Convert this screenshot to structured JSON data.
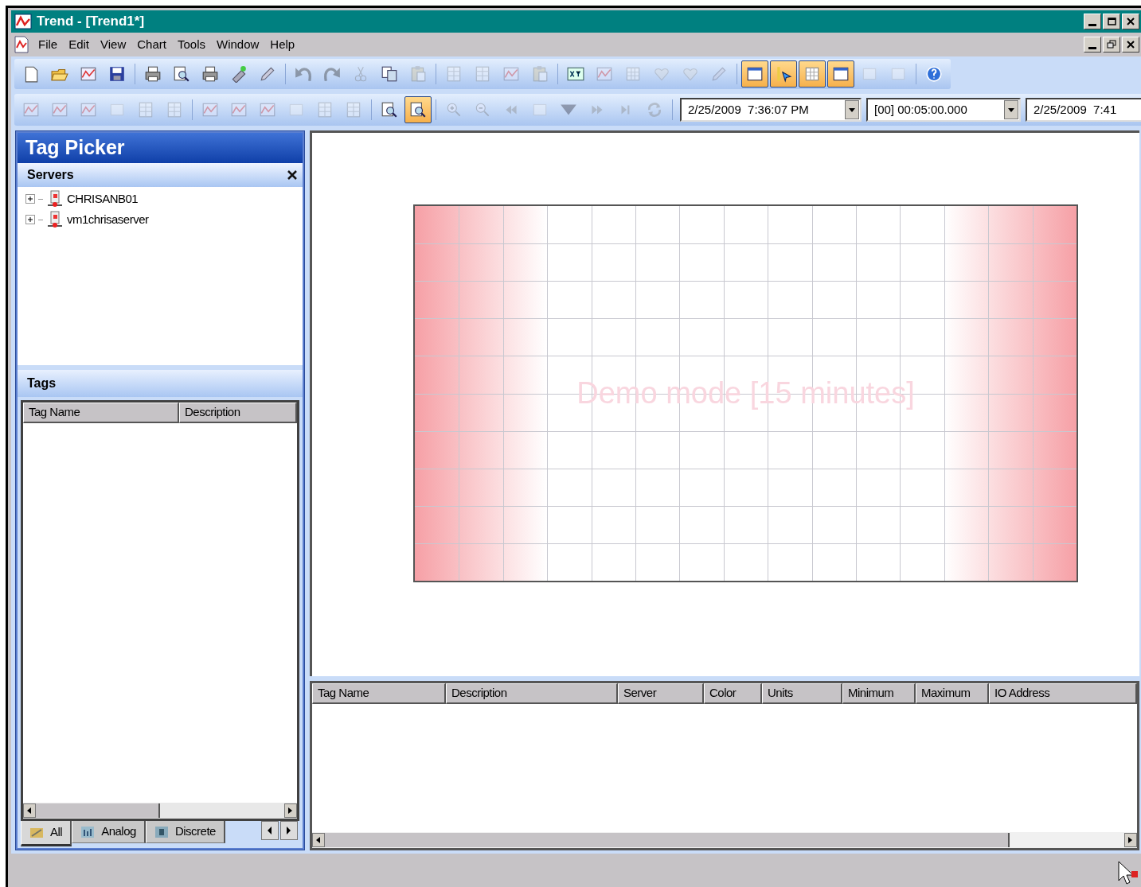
{
  "window": {
    "title": "Trend - [Trend1*]"
  },
  "menu_bar": {
    "items": [
      "File",
      "Edit",
      "View",
      "Chart",
      "Tools",
      "Window",
      "Help"
    ]
  },
  "toolbar_1": [
    {
      "kind": "page",
      "selected": false,
      "disabled": false
    },
    {
      "kind": "folder",
      "selected": false,
      "disabled": false
    },
    {
      "kind": "chart",
      "selected": false,
      "disabled": false
    },
    {
      "kind": "disk",
      "selected": false,
      "disabled": false
    },
    {
      "kind": "separator"
    },
    {
      "kind": "printer",
      "selected": false,
      "disabled": false
    },
    {
      "kind": "preview",
      "selected": false,
      "disabled": false
    },
    {
      "kind": "printer",
      "selected": false,
      "disabled": false
    },
    {
      "kind": "plug",
      "selected": false,
      "disabled": false
    },
    {
      "kind": "pencil",
      "selected": false,
      "disabled": false
    },
    {
      "kind": "separator"
    },
    {
      "kind": "undo",
      "selected": false,
      "disabled": true
    },
    {
      "kind": "redo",
      "selected": false,
      "disabled": true
    },
    {
      "kind": "cut",
      "selected": false,
      "disabled": true
    },
    {
      "kind": "copy",
      "selected": false,
      "disabled": false
    },
    {
      "kind": "paste",
      "selected": false,
      "disabled": true
    },
    {
      "kind": "separator"
    },
    {
      "kind": "table",
      "selected": false,
      "disabled": true
    },
    {
      "kind": "table",
      "selected": false,
      "disabled": true
    },
    {
      "kind": "chart",
      "selected": false,
      "disabled": true
    },
    {
      "kind": "paste",
      "selected": false,
      "disabled": true
    },
    {
      "kind": "separator"
    },
    {
      "kind": "xy",
      "selected": false,
      "disabled": false
    },
    {
      "kind": "chart",
      "selected": false,
      "disabled": true
    },
    {
      "kind": "grid",
      "selected": false,
      "disabled": true
    },
    {
      "kind": "heart",
      "selected": false,
      "disabled": true
    },
    {
      "kind": "heart",
      "selected": false,
      "disabled": true
    },
    {
      "kind": "pencil",
      "selected": false,
      "disabled": true
    },
    {
      "kind": "separator"
    },
    {
      "kind": "window",
      "selected": true,
      "disabled": false
    },
    {
      "kind": "pointer",
      "selected": true,
      "disabled": false
    },
    {
      "kind": "grid",
      "selected": true,
      "disabled": false
    },
    {
      "kind": "window",
      "selected": true,
      "disabled": false
    },
    {
      "kind": "square",
      "selected": false,
      "disabled": true
    },
    {
      "kind": "square",
      "selected": false,
      "disabled": true
    },
    {
      "kind": "separator"
    },
    {
      "kind": "help",
      "selected": false,
      "disabled": false
    }
  ],
  "toolbar_2": [
    {
      "kind": "chart",
      "selected": false,
      "disabled": true
    },
    {
      "kind": "chart",
      "selected": false,
      "disabled": true
    },
    {
      "kind": "chart",
      "selected": false,
      "disabled": true
    },
    {
      "kind": "square",
      "selected": false,
      "disabled": true
    },
    {
      "kind": "table",
      "selected": false,
      "disabled": true
    },
    {
      "kind": "table",
      "selected": false,
      "disabled": true
    },
    {
      "kind": "separator"
    },
    {
      "kind": "chart",
      "selected": false,
      "disabled": true
    },
    {
      "kind": "chart",
      "selected": false,
      "disabled": true
    },
    {
      "kind": "chart",
      "selected": false,
      "disabled": true
    },
    {
      "kind": "square",
      "selected": false,
      "disabled": true
    },
    {
      "kind": "table",
      "selected": false,
      "disabled": true
    },
    {
      "kind": "table",
      "selected": false,
      "disabled": true
    },
    {
      "kind": "separator"
    },
    {
      "kind": "preview",
      "selected": false,
      "disabled": false
    },
    {
      "kind": "preview",
      "selected": true,
      "disabled": false
    },
    {
      "kind": "separator"
    },
    {
      "kind": "zoomin",
      "selected": false,
      "disabled": true
    },
    {
      "kind": "zoomout",
      "selected": false,
      "disabled": true
    },
    {
      "kind": "rewind",
      "selected": false,
      "disabled": true
    },
    {
      "kind": "square",
      "selected": false,
      "disabled": true
    },
    {
      "kind": "caret",
      "selected": false,
      "disabled": true
    },
    {
      "kind": "forward",
      "selected": false,
      "disabled": true
    },
    {
      "kind": "end",
      "selected": false,
      "disabled": true
    },
    {
      "kind": "refresh",
      "selected": false,
      "disabled": true
    },
    {
      "kind": "separator"
    }
  ],
  "time_fields": [
    "2/25/2009  7:36:07 PM",
    "[00] 00:05:00.000",
    "2/25/2009  7:41"
  ],
  "tag_picker": {
    "title": "Tag Picker",
    "servers": {
      "title": "Servers",
      "items": [
        {
          "label": "CHRISANB01",
          "expanded": false
        },
        {
          "label": "vm1chrisaserver",
          "expanded": false
        }
      ]
    },
    "tags": {
      "title": "Tags",
      "columns": [
        "Tag Name",
        "Description"
      ]
    },
    "tabs": [
      {
        "label": "All",
        "selected": true
      },
      {
        "label": "Analog",
        "selected": false
      },
      {
        "label": "Discrete",
        "selected": false
      }
    ]
  },
  "chart": {
    "watermark": "Demo mode [15 minutes]"
  },
  "tag_table": {
    "columns": [
      "Tag Name",
      "Description",
      "Server",
      "Color",
      "Units",
      "Minimum",
      "Maximum",
      "IO Address"
    ]
  }
}
